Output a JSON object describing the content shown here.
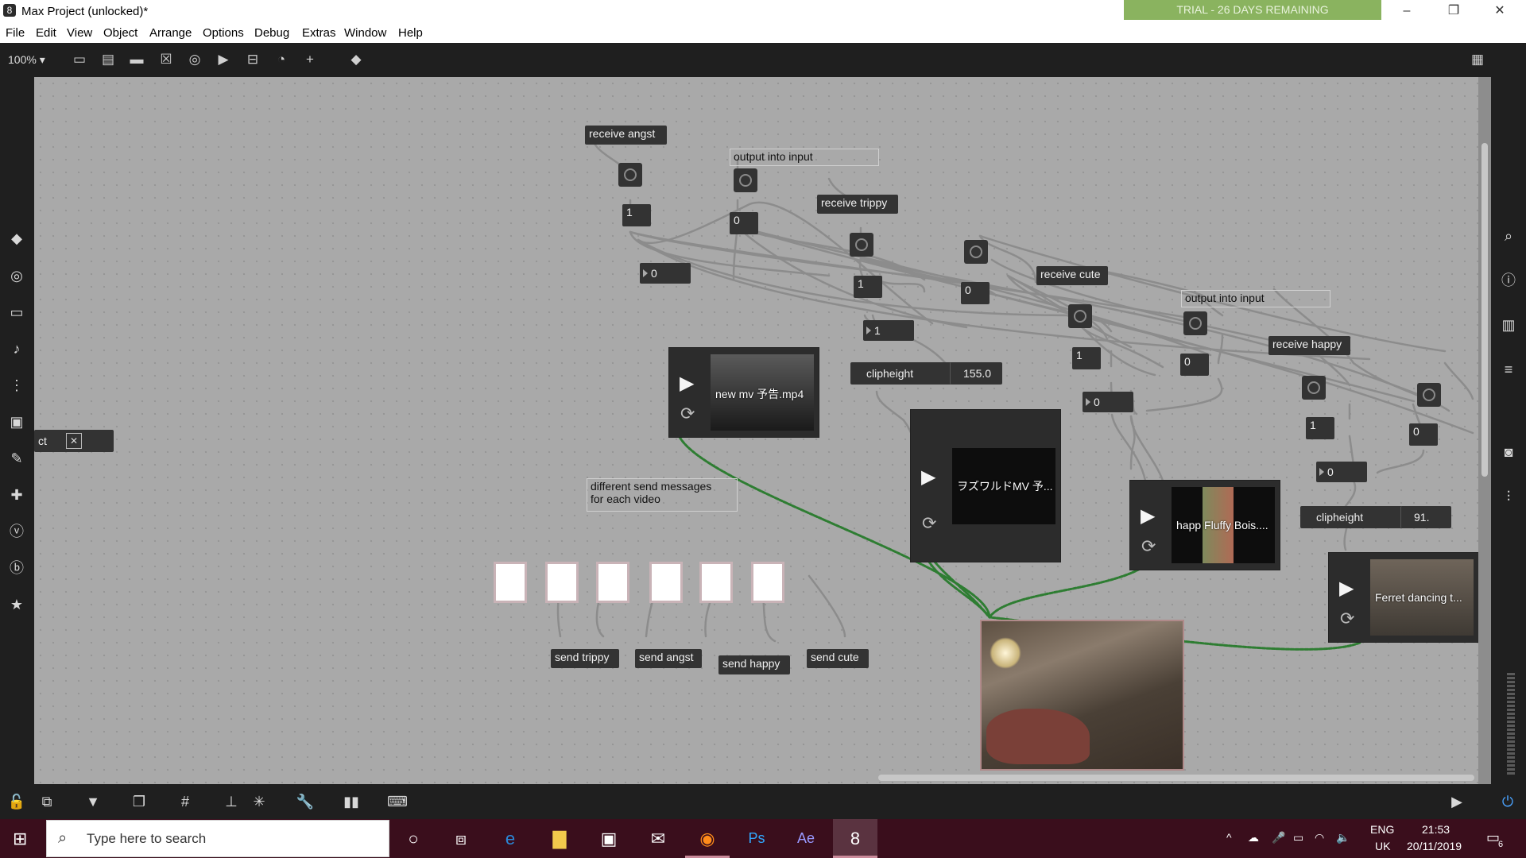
{
  "window": {
    "title": "Max Project (unlocked)*",
    "trial_banner": "TRIAL - 26 DAYS REMAINING",
    "minimize": "–",
    "maximize": "❐",
    "close": "✕"
  },
  "menu": [
    "File",
    "Edit",
    "View",
    "Object",
    "Arrange",
    "Options",
    "Debug",
    "Extras",
    "Window",
    "Help"
  ],
  "toolbar": {
    "zoom": "100% ▾"
  },
  "patch": {
    "receive_angst": "receive angst",
    "comment_output_1": "output into input",
    "receive_trippy": "receive trippy",
    "receive_cute": "receive cute",
    "comment_output_2": "output into input",
    "receive_happy": "receive happy",
    "num_a1": "1",
    "num_a2": "0",
    "num_a3": "0",
    "num_t1": "1",
    "num_t2": "0",
    "num_t3": "1",
    "num_c1": "1",
    "num_c2": "0",
    "num_c3": "0",
    "num_h1": "1",
    "num_h2": "0",
    "num_h3": "0",
    "attr1_label": "clipheight",
    "attr1_value": "155.0",
    "attr2_label": "clipheight",
    "attr2_value": "91.",
    "video1": "new mv 予告.mp4",
    "video2": "ヲズワルドMV 予...",
    "video3": "happ Fluffy Bois....",
    "video4": "Ferret dancing t...",
    "comment_sends": "different send messages\nfor each video",
    "send_trippy": "send trippy",
    "send_angst": "send angst",
    "send_happy": "send happy",
    "send_cute": "send cute",
    "partial_left": "ct"
  },
  "taskbar": {
    "search_placeholder": "Type here to search",
    "lang_line1": "ENG",
    "lang_line2": "UK",
    "time": "21:53",
    "date": "20/11/2019",
    "notifications": "6",
    "ps_label": "Ps",
    "ae_label": "Ae"
  },
  "colors": {
    "canvas": "#a9a9a9",
    "wire": "#8c8c8c",
    "video_wire": "#2e7d32",
    "trial": "#8ab35f",
    "taskbar": "#3a0e1c"
  }
}
